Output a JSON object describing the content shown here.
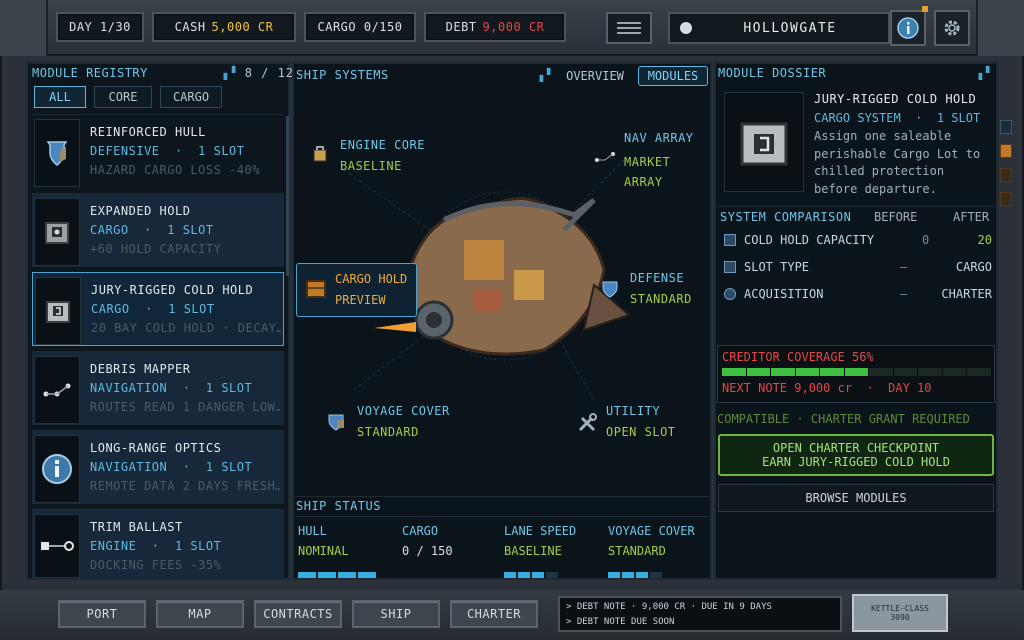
{
  "topbar": {
    "day_label": "DAY 1/30",
    "cash_label": "CASH",
    "cash_value": "5,000 CR",
    "cargo_label": "CARGO 0/150",
    "debt_label": "DEBT",
    "debt_value": "9,000 CR",
    "location": "HOLLOWGATE"
  },
  "registry": {
    "title": "MODULE REGISTRY",
    "count": "8 / 12",
    "filters": [
      "ALL",
      "CORE",
      "CARGO"
    ],
    "modules": [
      {
        "name": "REINFORCED HULL",
        "category": "DEFENSIVE  ·  1 SLOT",
        "desc": "HAZARD CARGO LOSS -40%"
      },
      {
        "name": "EXPANDED HOLD",
        "category": "CARGO  ·  1 SLOT",
        "desc": "+60 HOLD CAPACITY"
      },
      {
        "name": "JURY-RIGGED COLD HOLD",
        "category": "CARGO  ·  1 SLOT",
        "desc": "20 BAY COLD HOLD · DECAY…"
      },
      {
        "name": "DEBRIS MAPPER",
        "category": "NAVIGATION  ·  1 SLOT",
        "desc": "ROUTES READ 1 DANGER LOW…"
      },
      {
        "name": "LONG-RANGE OPTICS",
        "category": "NAVIGATION  ·  1 SLOT",
        "desc": "REMOTE DATA 2 DAYS FRESH…"
      },
      {
        "name": "TRIM BALLAST",
        "category": "ENGINE  ·  1 SLOT",
        "desc": "DOCKING FEES -35%"
      }
    ]
  },
  "ship_systems": {
    "title": "SHIP SYSTEMS",
    "tabs": [
      "OVERVIEW",
      "MODULES"
    ],
    "nodes": {
      "engine": {
        "name": "ENGINE CORE",
        "state": "BASELINE"
      },
      "nav": {
        "name": "NAV ARRAY",
        "state": "MARKET ARRAY"
      },
      "cargo": {
        "name": "CARGO HOLD",
        "state": "PREVIEW"
      },
      "defense": {
        "name": "DEFENSE",
        "state": "STANDARD"
      },
      "voyage": {
        "name": "VOYAGE COVER",
        "state": "STANDARD"
      },
      "utility": {
        "name": "UTILITY",
        "state": "OPEN SLOT"
      }
    }
  },
  "ship_status": {
    "title": "SHIP STATUS",
    "cols": [
      {
        "label": "HULL",
        "value": "NOMINAL",
        "bars": 4
      },
      {
        "label": "CARGO",
        "value": "0 / 150",
        "bars": 0
      },
      {
        "label": "LANE SPEED",
        "value": "BASELINE",
        "bars": 3
      },
      {
        "label": "VOYAGE COVER",
        "value": "STANDARD",
        "bars": 3
      }
    ]
  },
  "dossier": {
    "title": "MODULE DOSSIER",
    "name": "JURY-RIGGED COLD HOLD",
    "system": "CARGO SYSTEM  ·  1 SLOT",
    "desc": "Assign one saleable perishable Cargo Lot to chilled protection before departure.",
    "comparison_title": "SYSTEM COMPARISON",
    "before_label": "BEFORE",
    "after_label": "AFTER",
    "rows": [
      {
        "label": "COLD HOLD CAPACITY",
        "before": "0",
        "after": "20"
      },
      {
        "label": "SLOT TYPE",
        "before": "—",
        "after": "CARGO"
      },
      {
        "label": "ACQUISITION",
        "before": "—",
        "after": "CHARTER"
      }
    ],
    "coverage_label": "CREDITOR COVERAGE 56%",
    "coverage_fraction": 0.56,
    "next_note": "NEXT NOTE 9,000 cr  ·  DAY 10",
    "compat": "COMPATIBLE  ·  CHARTER GRANT REQUIRED",
    "primary_line1": "OPEN CHARTER CHECKPOINT",
    "primary_line2": "EARN JURY-RIGGED COLD HOLD",
    "secondary": "BROWSE MODULES"
  },
  "bottom": {
    "nav": [
      "PORT",
      "MAP",
      "CONTRACTS",
      "SHIP",
      "CHARTER"
    ],
    "log1": "> DEBT NOTE · 9,000 CR · DUE IN 9 DAYS",
    "log2": "> DEBT NOTE DUE SOON",
    "plate1": "KETTLE-CLASS",
    "plate2": "3090"
  },
  "colors": {
    "accent": "#6fc6e6",
    "green": "#a8c94a",
    "red": "#e04848",
    "cash": "#f0c23a"
  }
}
